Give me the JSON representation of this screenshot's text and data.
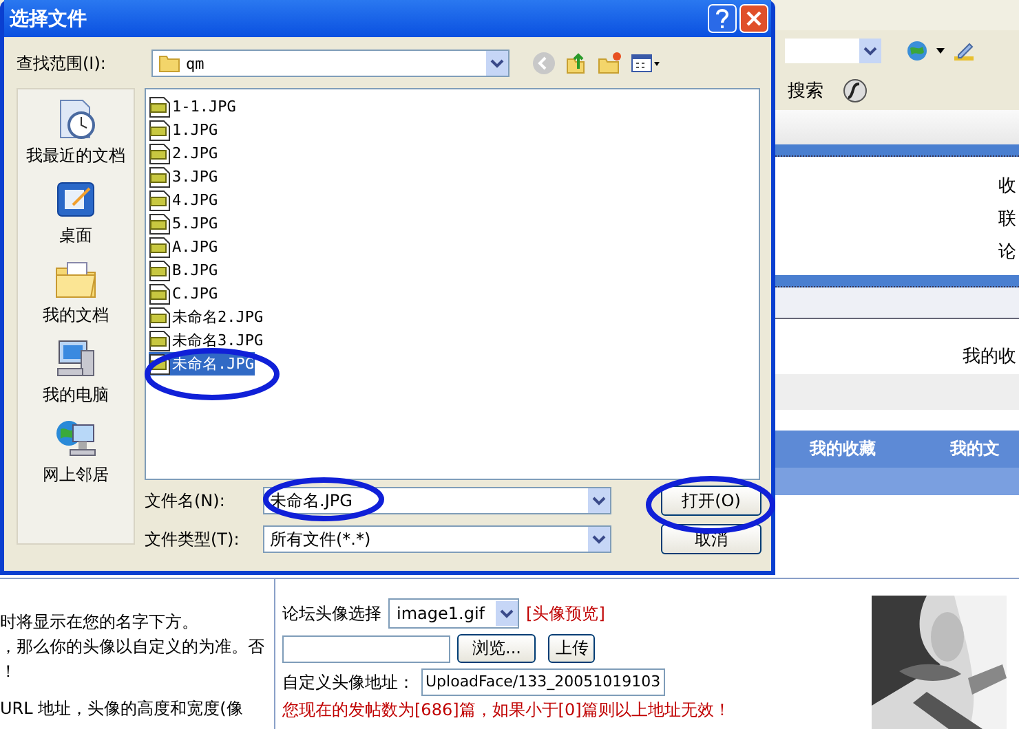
{
  "dialog": {
    "title": "选择文件",
    "look_in_label": "查找范围(I):",
    "look_in_value": "qm",
    "places": [
      {
        "label": "我最近的文档",
        "kind": "recent"
      },
      {
        "label": "桌面",
        "kind": "desktop"
      },
      {
        "label": "我的文档",
        "kind": "documents"
      },
      {
        "label": "我的电脑",
        "kind": "computer"
      },
      {
        "label": "网上邻居",
        "kind": "network"
      }
    ],
    "files": [
      {
        "name": "1-1.JPG",
        "selected": false
      },
      {
        "name": "1.JPG",
        "selected": false
      },
      {
        "name": "2.JPG",
        "selected": false
      },
      {
        "name": "3.JPG",
        "selected": false
      },
      {
        "name": "4.JPG",
        "selected": false
      },
      {
        "name": "5.JPG",
        "selected": false
      },
      {
        "name": "A.JPG",
        "selected": false
      },
      {
        "name": "B.JPG",
        "selected": false
      },
      {
        "name": "C.JPG",
        "selected": false
      },
      {
        "name": "未命名2.JPG",
        "selected": false
      },
      {
        "name": "未命名3.JPG",
        "selected": false
      },
      {
        "name": "未命名.JPG",
        "selected": true
      }
    ],
    "file_name_label": "文件名(N):",
    "file_name_value": "未命名.JPG",
    "file_type_label": "文件类型(T):",
    "file_type_value": "所有文件(*.*)",
    "open_button": "打开(O)",
    "cancel_button": "取消"
  },
  "browser": {
    "search_text": "搜索",
    "side_links": [
      "收",
      "联",
      "论"
    ],
    "panel_text": "我的收",
    "nav_tabs": [
      "我的收藏",
      "我的文"
    ]
  },
  "profile": {
    "help_lines": [
      "时将显示在您的名字下方。",
      "，那么你的头像以自定义的为准。否",
      "！",
      "URL 地址，头像的高度和宽度(像"
    ],
    "avatar_select_label": "论坛头像选择",
    "avatar_select_value": "image1.gif",
    "preview_link": "[头像预览]",
    "browse_button": "浏览...",
    "upload_button": "上传",
    "custom_label": "自定义头像地址：",
    "custom_value": "UploadFace/133_20051019103",
    "notice": "您现在的发帖数为[686]篇，如果小于[0]篇则以上地址无效！"
  }
}
